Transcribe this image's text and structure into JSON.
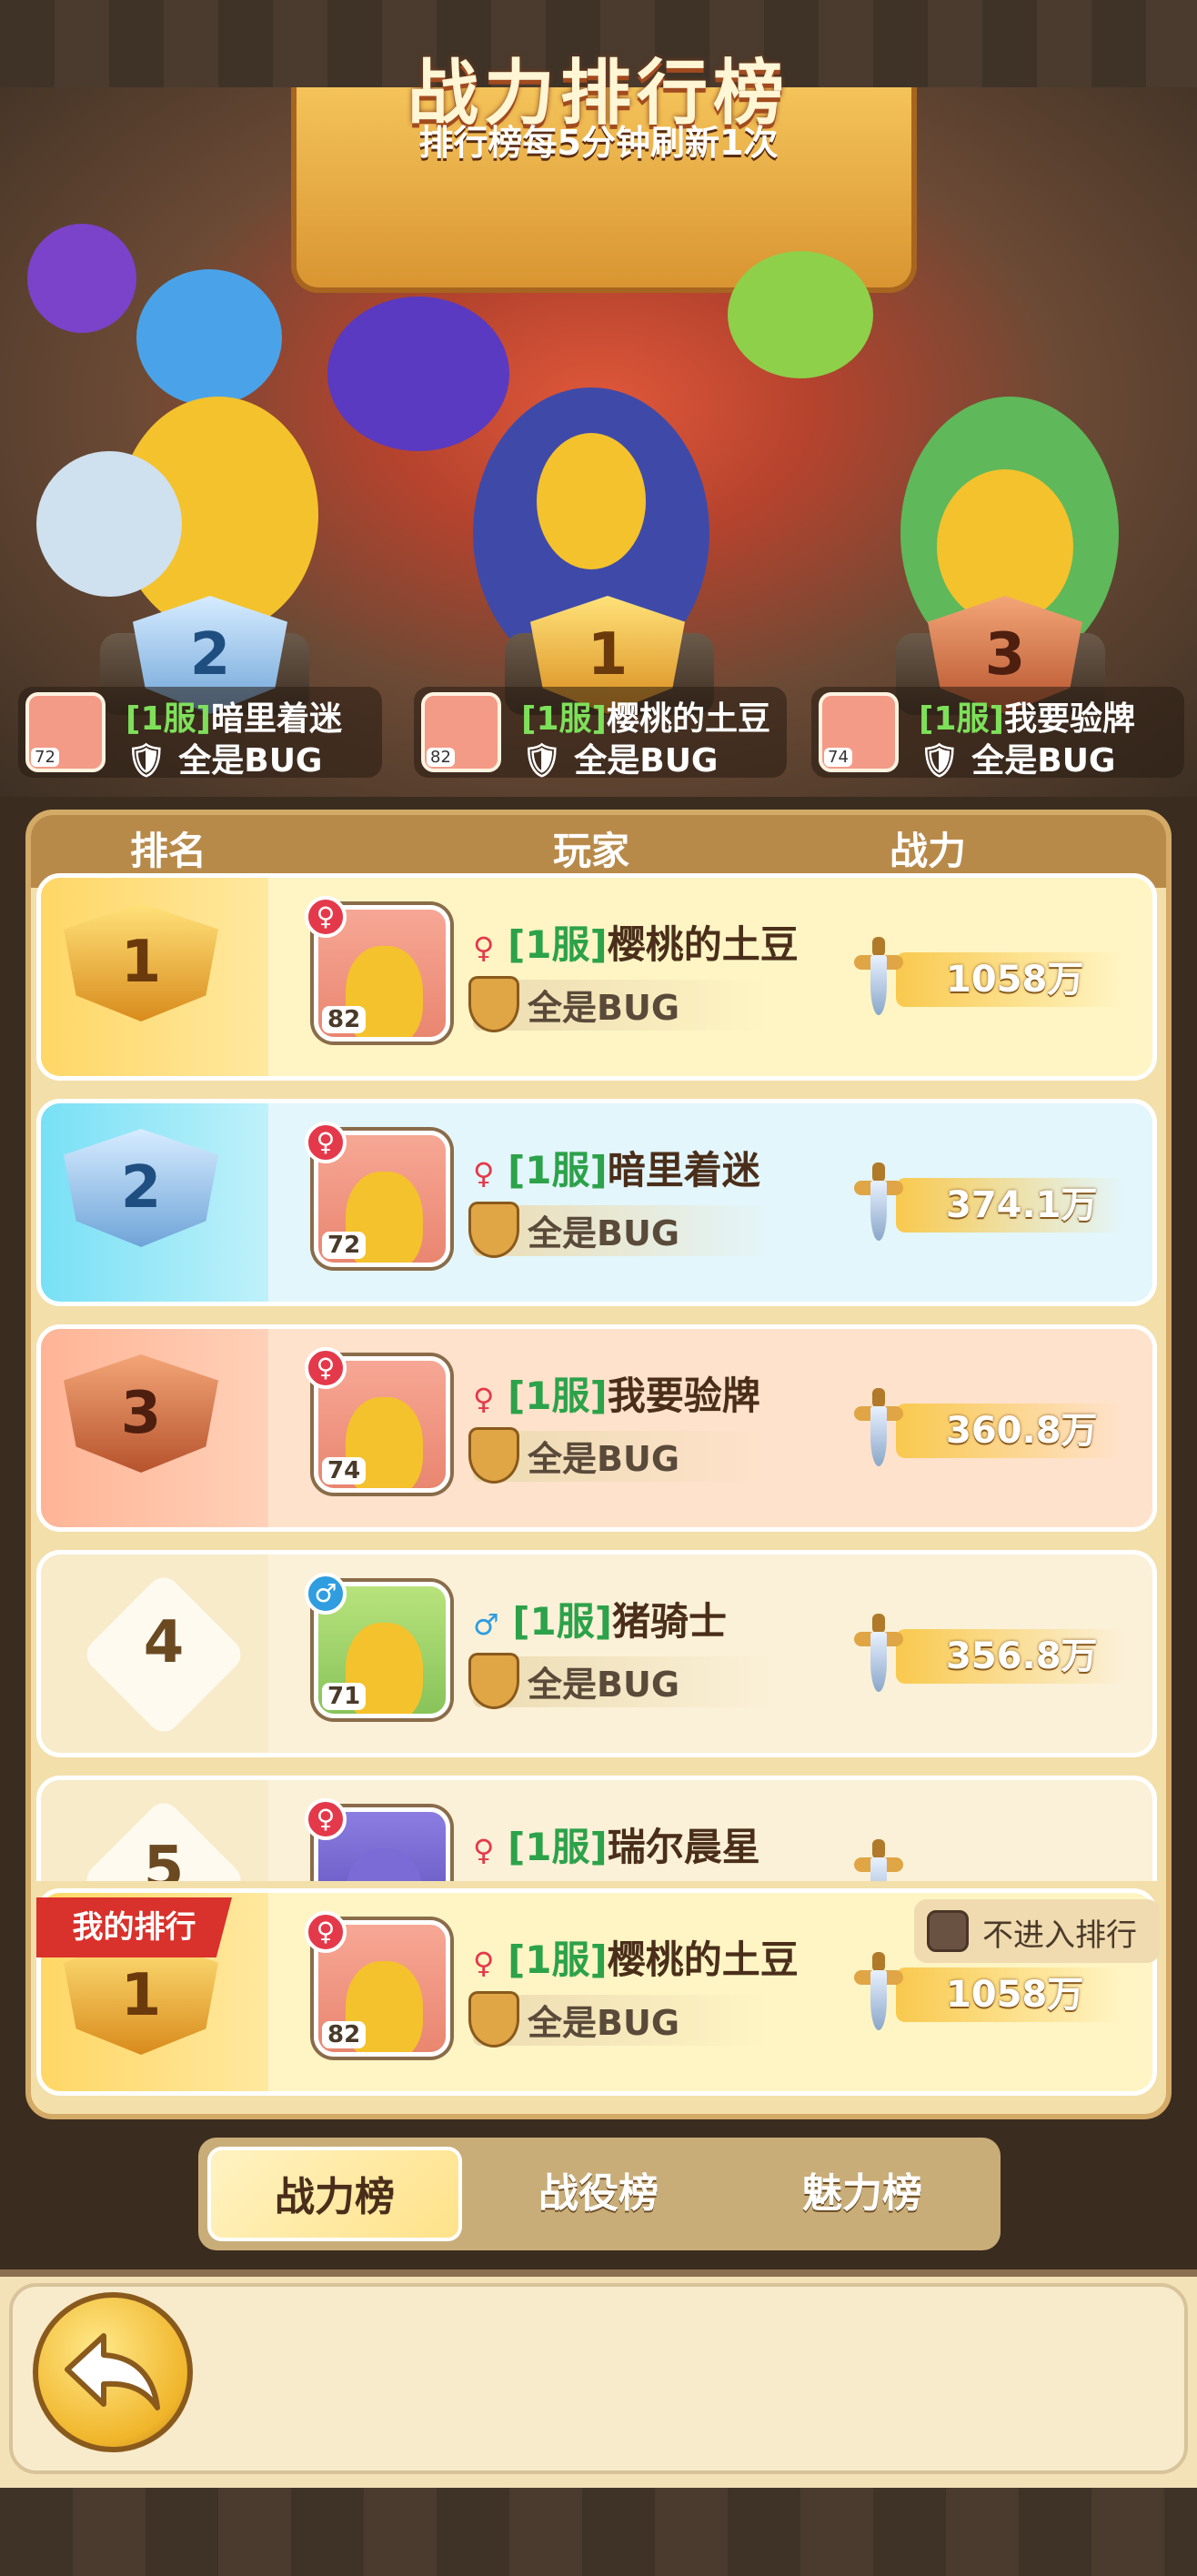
{
  "banner": {
    "title": "战力排行榜",
    "subtitle": "排行榜每5分钟刷新1次"
  },
  "podium": [
    {
      "rank": "2",
      "server": "[1服]",
      "name": "暗里着迷",
      "guild": "全是BUG",
      "level": "72",
      "gender": "♀"
    },
    {
      "rank": "1",
      "server": "[1服]",
      "name": "樱桃的土豆",
      "guild": "全是BUG",
      "level": "82",
      "gender": "♀"
    },
    {
      "rank": "3",
      "server": "[1服]",
      "name": "我要验牌",
      "guild": "全是BUG",
      "level": "74",
      "gender": "♀"
    }
  ],
  "table": {
    "headers": [
      "排名",
      "玩家",
      "战力"
    ],
    "rows": [
      {
        "rank": "1",
        "gender": "♀",
        "server": "[1服]",
        "name": "樱桃的土豆",
        "guild": "全是BUG",
        "level": "82",
        "power": "1058万"
      },
      {
        "rank": "2",
        "gender": "♀",
        "server": "[1服]",
        "name": "暗里着迷",
        "guild": "全是BUG",
        "level": "72",
        "power": "374.1万"
      },
      {
        "rank": "3",
        "gender": "♀",
        "server": "[1服]",
        "name": "我要验牌",
        "guild": "全是BUG",
        "level": "74",
        "power": "360.8万"
      },
      {
        "rank": "4",
        "gender": "♂",
        "server": "[1服]",
        "name": "猪骑士",
        "guild": "全是BUG",
        "level": "71",
        "power": "356.8万"
      },
      {
        "rank": "5",
        "gender": "♀",
        "server": "[1服]",
        "name": "瑞尔晨星",
        "guild": "",
        "level": "",
        "power": ""
      }
    ]
  },
  "my_rank": {
    "tag": "我的排行",
    "rank": "1",
    "gender": "♀",
    "server": "[1服]",
    "name": "樱桃的土豆",
    "guild": "全是BUG",
    "level": "82",
    "power": "1058万",
    "opt_out_label": "不进入排行"
  },
  "tabs": [
    {
      "label": "战力榜",
      "active": true
    },
    {
      "label": "战役榜",
      "active": false
    },
    {
      "label": "魅力榜",
      "active": false
    }
  ],
  "icons": {
    "back": "back-arrow-icon",
    "power": "sword-icon",
    "guild": "guild-emblem-icon"
  },
  "colors": {
    "gold": "#f4c35a",
    "server_green": "#2ca24a",
    "female": "#e4394a",
    "male": "#2f9de0",
    "my_tag": "#d9312b"
  }
}
